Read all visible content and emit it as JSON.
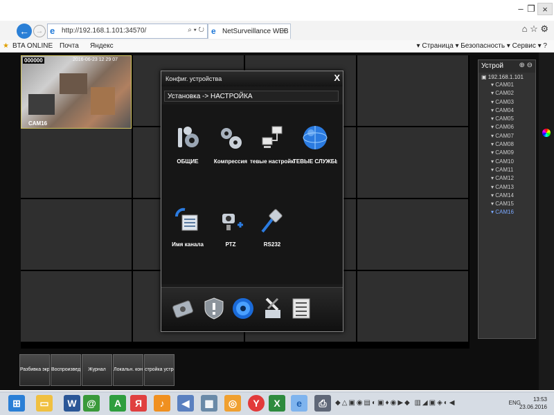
{
  "browser": {
    "url": "http://192.168.1.101:34570/",
    "address_controls": "⌕ ▾ ↻",
    "tab_title": "NetSurveillance WEB",
    "tab_close": "×",
    "min": "–",
    "restore": "❐",
    "close": "×",
    "right_icons": "⌂ ☆ ⚙",
    "favorites": [
      {
        "label": "BTA ONLINE"
      },
      {
        "label": "Почта"
      },
      {
        "label": "Яндекс"
      }
    ],
    "commands": "▾ Страница ▾  Безопасность ▾  Сервис ▾  ?"
  },
  "camera": {
    "code": "000000",
    "timestamp": "2016-06-23 12 29 07",
    "label": "CAM16"
  },
  "device_tree": {
    "title": "Устрой",
    "plus_minus": "⊕ ⊖",
    "root": "192.168.1.101",
    "items": [
      "CAM01",
      "CAM02",
      "CAM03",
      "CAM04",
      "CAM05",
      "CAM06",
      "CAM07",
      "CAM08",
      "CAM09",
      "CAM10",
      "CAM11",
      "CAM12",
      "CAM13",
      "CAM14",
      "CAM15",
      "CAM16"
    ],
    "selected": "CAM16"
  },
  "dialog": {
    "title": "Конфиг. устройства",
    "close": "X",
    "breadcrumb": "Установка -> НАСТРОЙКА",
    "items": [
      {
        "label": "ОБЩИЕ",
        "icon": "tools-gear-icon"
      },
      {
        "label": "Компрессия",
        "icon": "compression-gear-icon"
      },
      {
        "label": "тевые настройки",
        "icon": "network-computers-icon"
      },
      {
        "label": "ТЕВЫЕ СЛУЖБЫ",
        "icon": "globe-icon"
      },
      {
        "label": "Имя канала",
        "icon": "channel-name-icon"
      },
      {
        "label": "PTZ",
        "icon": "ptz-camera-icon"
      },
      {
        "label": "RS232",
        "icon": "rs232-cable-icon"
      }
    ],
    "footer_icons": [
      "hdd-icon",
      "shield-icon",
      "settings-gear-icon",
      "tools-icon",
      "checklist-icon"
    ]
  },
  "bottom_tabs": [
    {
      "label": "Разбивка экра"
    },
    {
      "label": "Воспроизведе"
    },
    {
      "label": "Журнал"
    },
    {
      "label": "Локальн. конфи"
    },
    {
      "label": "стройка устро"
    }
  ],
  "taskbar": {
    "apps": [
      "windows-start-icon",
      "file-explorer-icon",
      "word-icon",
      "chrome-like-icon",
      "green-a-icon",
      "yandex-icon",
      "music-icon",
      "speaker-icon",
      "control-panel-icon",
      "ring-icon",
      "yandex-browser-icon",
      "excel-icon",
      "ie-icon",
      "printer-icon"
    ],
    "lang": "ENG",
    "time": "13:53",
    "date": "23.06.2016"
  },
  "colors": {
    "accent": "#2a7fd6",
    "dialog_bg": "#1b1b1b",
    "grid_cell": "#2f2f2f",
    "selected_cam": "#7aa8ff"
  }
}
